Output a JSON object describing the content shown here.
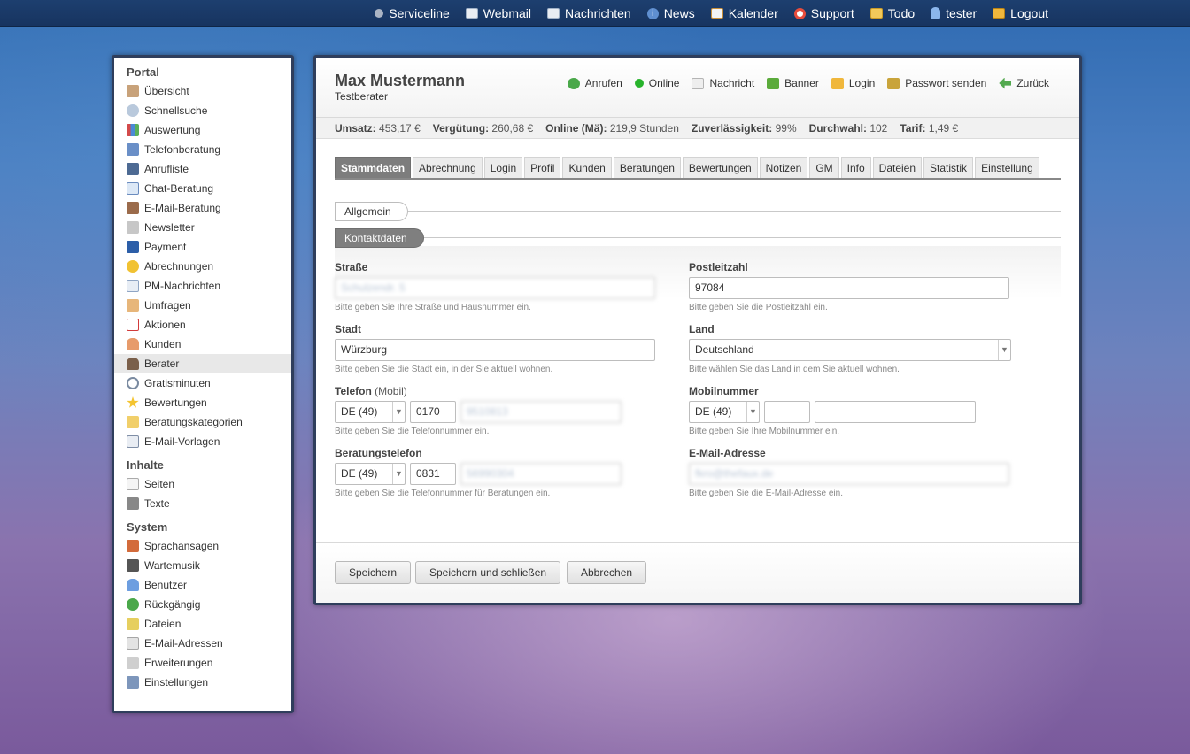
{
  "topnav": [
    {
      "label": "Serviceline",
      "icon": "serviceline-dot-icon"
    },
    {
      "label": "Webmail",
      "icon": "webmail-icon"
    },
    {
      "label": "Nachrichten",
      "icon": "envelope-icon"
    },
    {
      "label": "News",
      "icon": "info-icon"
    },
    {
      "label": "Kalender",
      "icon": "calendar-icon"
    },
    {
      "label": "Support",
      "icon": "lifebuoy-icon"
    },
    {
      "label": "Todo",
      "icon": "todo-icon"
    },
    {
      "label": "tester",
      "icon": "user-icon"
    },
    {
      "label": "Logout",
      "icon": "lock-icon"
    }
  ],
  "sidebar": {
    "sections": [
      {
        "title": "Portal",
        "items": [
          {
            "label": "Übersicht",
            "icon": "coffee-icon"
          },
          {
            "label": "Schnellsuche",
            "icon": "search-icon"
          },
          {
            "label": "Auswertung",
            "icon": "chart-icon"
          },
          {
            "label": "Telefonberatung",
            "icon": "phone-icon"
          },
          {
            "label": "Anrufliste",
            "icon": "monitor-icon"
          },
          {
            "label": "Chat-Beratung",
            "icon": "chat-icon"
          },
          {
            "label": "E-Mail-Beratung",
            "icon": "email-advisor-icon"
          },
          {
            "label": "Newsletter",
            "icon": "newsletter-icon"
          },
          {
            "label": "Payment",
            "icon": "paypal-icon"
          },
          {
            "label": "Abrechnungen",
            "icon": "coins-icon"
          },
          {
            "label": "PM-Nachrichten",
            "icon": "pm-icon"
          },
          {
            "label": "Umfragen",
            "icon": "poll-icon"
          },
          {
            "label": "Aktionen",
            "icon": "calendar-icon"
          },
          {
            "label": "Kunden",
            "icon": "customer-icon"
          },
          {
            "label": "Berater",
            "icon": "advisor-icon",
            "active": true
          },
          {
            "label": "Gratisminuten",
            "icon": "clock-icon"
          },
          {
            "label": "Bewertungen",
            "icon": "star-icon"
          },
          {
            "label": "Beratungskategorien",
            "icon": "folder-icon"
          },
          {
            "label": "E-Mail-Vorlagen",
            "icon": "template-icon"
          }
        ]
      },
      {
        "title": "Inhalte",
        "items": [
          {
            "label": "Seiten",
            "icon": "page-icon"
          },
          {
            "label": "Texte",
            "icon": "text-icon"
          }
        ]
      },
      {
        "title": "System",
        "items": [
          {
            "label": "Sprachansagen",
            "icon": "megaphone-icon"
          },
          {
            "label": "Wartemusik",
            "icon": "music-icon"
          },
          {
            "label": "Benutzer",
            "icon": "users-icon"
          },
          {
            "label": "Rückgängig",
            "icon": "undo-icon"
          },
          {
            "label": "Dateien",
            "icon": "files-icon"
          },
          {
            "label": "E-Mail-Adressen",
            "icon": "mail-addresses-icon"
          },
          {
            "label": "Erweiterungen",
            "icon": "extensions-icon"
          },
          {
            "label": "Einstellungen",
            "icon": "wrench-icon"
          }
        ]
      }
    ]
  },
  "header": {
    "name": "Max Mustermann",
    "role": "Testberater",
    "actions": [
      {
        "label": "Anrufen",
        "icon": "call-icon"
      },
      {
        "label": "Online",
        "icon": "online-status-icon"
      },
      {
        "label": "Nachricht",
        "icon": "message-icon"
      },
      {
        "label": "Banner",
        "icon": "banner-icon"
      },
      {
        "label": "Login",
        "icon": "login-icon"
      },
      {
        "label": "Passwort senden",
        "icon": "password-icon"
      },
      {
        "label": "Zurück",
        "icon": "back-arrow-icon"
      }
    ]
  },
  "stats": [
    {
      "label": "Umsatz:",
      "value": "453,17 €"
    },
    {
      "label": "Vergütung:",
      "value": "260,68 €"
    },
    {
      "label": "Online (Mä):",
      "value": "219,9 Stunden"
    },
    {
      "label": "Zuverlässigkeit:",
      "value": "99%"
    },
    {
      "label": "Durchwahl:",
      "value": "102"
    },
    {
      "label": "Tarif:",
      "value": "1,49 €"
    }
  ],
  "tabs": [
    "Stammdaten",
    "Abrechnung",
    "Login",
    "Profil",
    "Kunden",
    "Beratungen",
    "Bewertungen",
    "Notizen",
    "GM",
    "Info",
    "Dateien",
    "Statistik",
    "Einstellung"
  ],
  "sections": {
    "general": "Allgemein",
    "contact": "Kontaktdaten"
  },
  "form": {
    "street": {
      "label": "Straße",
      "value": "Schulzendr. 5",
      "hint": "Bitte geben Sie Ihre Straße und Hausnummer ein."
    },
    "zip": {
      "label": "Postleitzahl",
      "value": "97084",
      "hint": "Bitte geben Sie die Postleitzahl ein."
    },
    "city": {
      "label": "Stadt",
      "value": "Würzburg",
      "hint": "Bitte geben Sie die Stadt ein, in der Sie aktuell wohnen."
    },
    "country": {
      "label": "Land",
      "value": "Deutschland",
      "hint": "Bitte wählen Sie das Land in dem Sie aktuell wohnen."
    },
    "phone": {
      "label": "Telefon",
      "label_extra": "(Mobil)",
      "country": "DE (49)",
      "prefix": "0170",
      "number": "9510813",
      "hint": "Bitte geben Sie die Telefonnummer ein."
    },
    "mobile": {
      "label": "Mobilnummer",
      "country": "DE (49)",
      "prefix": "",
      "number": "",
      "hint": "Bitte geben Sie Ihre Mobilnummer ein."
    },
    "advice_phone": {
      "label": "Beratungstelefon",
      "country": "DE (49)",
      "prefix": "0831",
      "number": "56990304",
      "hint": "Bitte geben Sie die Telefonnummer für Beratungen ein."
    },
    "email": {
      "label": "E-Mail-Adresse",
      "value": "fkro@thefaux.de",
      "hint": "Bitte geben Sie die E-Mail-Adresse ein."
    }
  },
  "buttons": {
    "save": "Speichern",
    "save_close": "Speichern und schließen",
    "cancel": "Abbrechen"
  }
}
